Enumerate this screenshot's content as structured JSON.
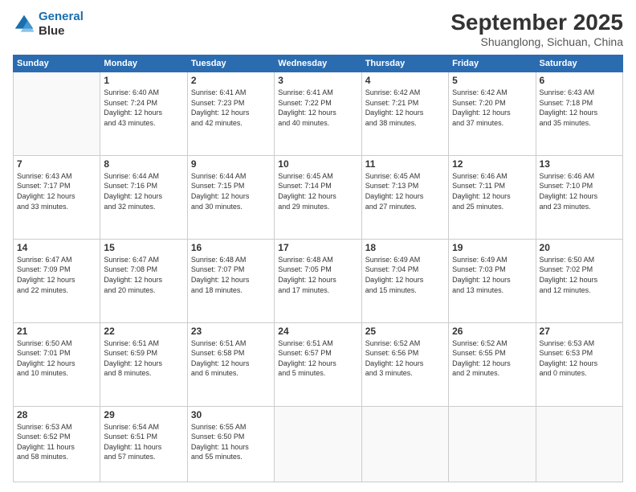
{
  "header": {
    "logo_line1": "General",
    "logo_line2": "Blue",
    "month": "September 2025",
    "location": "Shuanglong, Sichuan, China"
  },
  "days_of_week": [
    "Sunday",
    "Monday",
    "Tuesday",
    "Wednesday",
    "Thursday",
    "Friday",
    "Saturday"
  ],
  "weeks": [
    [
      {
        "day": "",
        "detail": ""
      },
      {
        "day": "1",
        "detail": "Sunrise: 6:40 AM\nSunset: 7:24 PM\nDaylight: 12 hours\nand 43 minutes."
      },
      {
        "day": "2",
        "detail": "Sunrise: 6:41 AM\nSunset: 7:23 PM\nDaylight: 12 hours\nand 42 minutes."
      },
      {
        "day": "3",
        "detail": "Sunrise: 6:41 AM\nSunset: 7:22 PM\nDaylight: 12 hours\nand 40 minutes."
      },
      {
        "day": "4",
        "detail": "Sunrise: 6:42 AM\nSunset: 7:21 PM\nDaylight: 12 hours\nand 38 minutes."
      },
      {
        "day": "5",
        "detail": "Sunrise: 6:42 AM\nSunset: 7:20 PM\nDaylight: 12 hours\nand 37 minutes."
      },
      {
        "day": "6",
        "detail": "Sunrise: 6:43 AM\nSunset: 7:18 PM\nDaylight: 12 hours\nand 35 minutes."
      }
    ],
    [
      {
        "day": "7",
        "detail": "Sunrise: 6:43 AM\nSunset: 7:17 PM\nDaylight: 12 hours\nand 33 minutes."
      },
      {
        "day": "8",
        "detail": "Sunrise: 6:44 AM\nSunset: 7:16 PM\nDaylight: 12 hours\nand 32 minutes."
      },
      {
        "day": "9",
        "detail": "Sunrise: 6:44 AM\nSunset: 7:15 PM\nDaylight: 12 hours\nand 30 minutes."
      },
      {
        "day": "10",
        "detail": "Sunrise: 6:45 AM\nSunset: 7:14 PM\nDaylight: 12 hours\nand 29 minutes."
      },
      {
        "day": "11",
        "detail": "Sunrise: 6:45 AM\nSunset: 7:13 PM\nDaylight: 12 hours\nand 27 minutes."
      },
      {
        "day": "12",
        "detail": "Sunrise: 6:46 AM\nSunset: 7:11 PM\nDaylight: 12 hours\nand 25 minutes."
      },
      {
        "day": "13",
        "detail": "Sunrise: 6:46 AM\nSunset: 7:10 PM\nDaylight: 12 hours\nand 23 minutes."
      }
    ],
    [
      {
        "day": "14",
        "detail": "Sunrise: 6:47 AM\nSunset: 7:09 PM\nDaylight: 12 hours\nand 22 minutes."
      },
      {
        "day": "15",
        "detail": "Sunrise: 6:47 AM\nSunset: 7:08 PM\nDaylight: 12 hours\nand 20 minutes."
      },
      {
        "day": "16",
        "detail": "Sunrise: 6:48 AM\nSunset: 7:07 PM\nDaylight: 12 hours\nand 18 minutes."
      },
      {
        "day": "17",
        "detail": "Sunrise: 6:48 AM\nSunset: 7:05 PM\nDaylight: 12 hours\nand 17 minutes."
      },
      {
        "day": "18",
        "detail": "Sunrise: 6:49 AM\nSunset: 7:04 PM\nDaylight: 12 hours\nand 15 minutes."
      },
      {
        "day": "19",
        "detail": "Sunrise: 6:49 AM\nSunset: 7:03 PM\nDaylight: 12 hours\nand 13 minutes."
      },
      {
        "day": "20",
        "detail": "Sunrise: 6:50 AM\nSunset: 7:02 PM\nDaylight: 12 hours\nand 12 minutes."
      }
    ],
    [
      {
        "day": "21",
        "detail": "Sunrise: 6:50 AM\nSunset: 7:01 PM\nDaylight: 12 hours\nand 10 minutes."
      },
      {
        "day": "22",
        "detail": "Sunrise: 6:51 AM\nSunset: 6:59 PM\nDaylight: 12 hours\nand 8 minutes."
      },
      {
        "day": "23",
        "detail": "Sunrise: 6:51 AM\nSunset: 6:58 PM\nDaylight: 12 hours\nand 6 minutes."
      },
      {
        "day": "24",
        "detail": "Sunrise: 6:51 AM\nSunset: 6:57 PM\nDaylight: 12 hours\nand 5 minutes."
      },
      {
        "day": "25",
        "detail": "Sunrise: 6:52 AM\nSunset: 6:56 PM\nDaylight: 12 hours\nand 3 minutes."
      },
      {
        "day": "26",
        "detail": "Sunrise: 6:52 AM\nSunset: 6:55 PM\nDaylight: 12 hours\nand 2 minutes."
      },
      {
        "day": "27",
        "detail": "Sunrise: 6:53 AM\nSunset: 6:53 PM\nDaylight: 12 hours\nand 0 minutes."
      }
    ],
    [
      {
        "day": "28",
        "detail": "Sunrise: 6:53 AM\nSunset: 6:52 PM\nDaylight: 11 hours\nand 58 minutes."
      },
      {
        "day": "29",
        "detail": "Sunrise: 6:54 AM\nSunset: 6:51 PM\nDaylight: 11 hours\nand 57 minutes."
      },
      {
        "day": "30",
        "detail": "Sunrise: 6:55 AM\nSunset: 6:50 PM\nDaylight: 11 hours\nand 55 minutes."
      },
      {
        "day": "",
        "detail": ""
      },
      {
        "day": "",
        "detail": ""
      },
      {
        "day": "",
        "detail": ""
      },
      {
        "day": "",
        "detail": ""
      }
    ]
  ]
}
